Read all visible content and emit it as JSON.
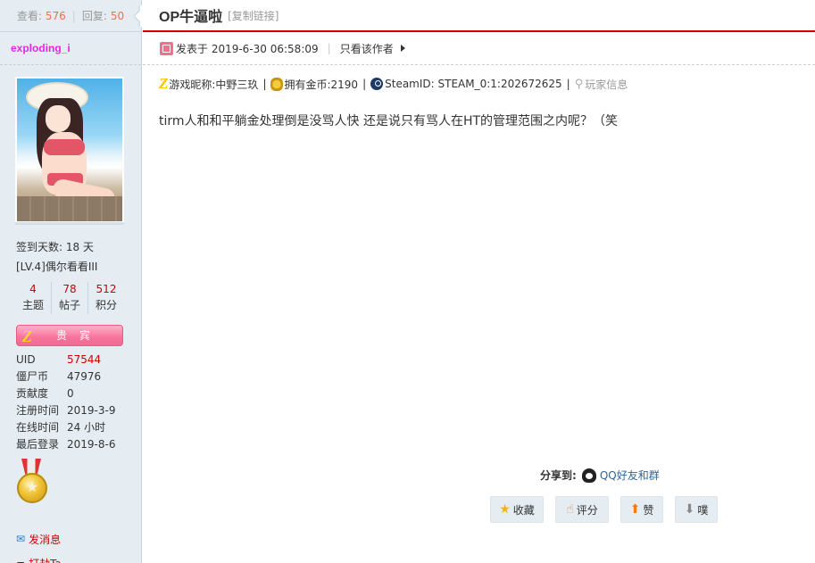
{
  "stats": {
    "views_label": "查看:",
    "views": "576",
    "replies_label": "回复:",
    "replies": "50"
  },
  "author": {
    "name": "exploding_i",
    "checkin": "签到天数: 18 天",
    "level": "[LV.4]偶尔看看III",
    "counts": [
      {
        "value": "4",
        "label": "主题"
      },
      {
        "value": "78",
        "label": "帖子"
      },
      {
        "value": "512",
        "label": "积分"
      }
    ],
    "badge": "贵宾",
    "details": [
      {
        "key": "UID",
        "value": "57544",
        "highlight": true
      },
      {
        "key": "僵尸币",
        "value": "47976",
        "highlight": false
      },
      {
        "key": "贡献度",
        "value": "0",
        "highlight": false
      },
      {
        "key": "注册时间",
        "value": "2019-3-9",
        "highlight": false
      },
      {
        "key": "在线时间",
        "value": "24 小时",
        "highlight": false
      },
      {
        "key": "最后登录",
        "value": "2019-8-6",
        "highlight": false
      }
    ],
    "send_message": "发消息",
    "rob": "打劫Ta"
  },
  "thread": {
    "title": "OP牛逼啦",
    "copy_link": "[复制链接]"
  },
  "post": {
    "posted_at": "发表于 2019-6-30 06:58:09",
    "only_author": "只看该作者",
    "game_nick": "游戏昵称:中野三玖",
    "coins": "拥有金币:2190",
    "steam_id": "SteamID: STEAM_0:1:202672625",
    "player_info": "玩家信息",
    "body": "tirm人和和平躺金处理倒是没骂人快 还是说只有骂人在HT的管理范围之内呢？（笑"
  },
  "share": {
    "label": "分享到:",
    "qq": "QQ好友和群"
  },
  "actions": {
    "favorite": "收藏",
    "rate": "评分",
    "like": "赞",
    "dislike": "噗"
  },
  "colors": {
    "accent_red": "#cc0000",
    "author_name": "#ee22ee",
    "side_bg": "#e5edf2"
  }
}
